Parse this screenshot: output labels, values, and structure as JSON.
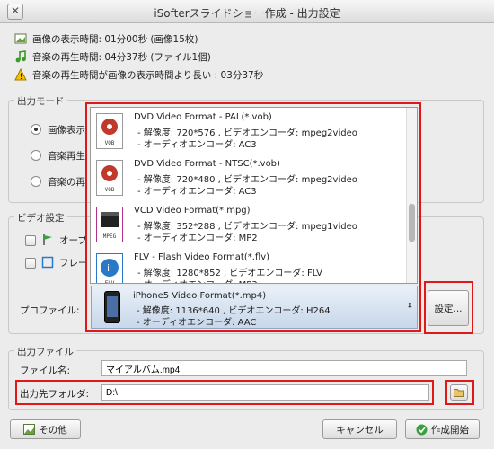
{
  "window": {
    "title": "iSofterスライドショー作成 - 出力設定"
  },
  "summary": {
    "image_time": "画像の表示時間: 01分00秒 (画像15枚)",
    "music_time": "音楽の再生時間: 04分37秒 (ファイル1個)",
    "warning": "音楽の再生時間が画像の表示時間より長い : 03分37秒"
  },
  "output_mode": {
    "title": "出力モード",
    "options": [
      "画像表示",
      "音楽再生",
      "音楽の再"
    ]
  },
  "video_settings": {
    "title": "ビデオ設定",
    "opening_label": "オープ",
    "frame_label": "フレー",
    "profile_label": "プロファイル:",
    "settings_button": "設定..."
  },
  "formats": [
    {
      "name": "DVD Video Format - PAL(*.vob)",
      "resolution": "- 解像度: 720*576 , ビデオエンコーダ: mpeg2video",
      "audio": "- オーディオエンコーダ: AC3",
      "icon": "VOB"
    },
    {
      "name": "DVD Video Format - NTSC(*.vob)",
      "resolution": "- 解像度: 720*480 , ビデオエンコーダ: mpeg2video",
      "audio": "- オーディオエンコーダ: AC3",
      "icon": "VOB"
    },
    {
      "name": "VCD Video Format(*.mpg)",
      "resolution": "- 解像度: 352*288 , ビデオエンコーダ: mpeg1video",
      "audio": "- オーディオエンコーダ: MP2",
      "icon": "MPEG"
    },
    {
      "name": "FLV - Flash Video Format(*.flv)",
      "resolution": "- 解像度: 1280*852 , ビデオエンコーダ: FLV",
      "audio": "- オーディオエンコーダ: MP3",
      "icon": "FLV"
    }
  ],
  "selected_profile": {
    "name": "iPhone5 Video Format(*.mp4)",
    "resolution": "- 解像度: 1136*640 , ビデオエンコーダ: H264",
    "audio": "- オーディオエンコーダ: AAC"
  },
  "output_file": {
    "title": "出力ファイル",
    "filename_label": "ファイル名:",
    "filename_value": "マイアルバム.mp4",
    "folder_label": "出力先フォルダ:",
    "folder_value": "D:\\"
  },
  "footer": {
    "other_button": "その他",
    "cancel_button": "キャンセル",
    "start_button": "作成開始"
  },
  "colors": {
    "highlight_box": "#e01818",
    "selection": "#c8d7ea"
  }
}
